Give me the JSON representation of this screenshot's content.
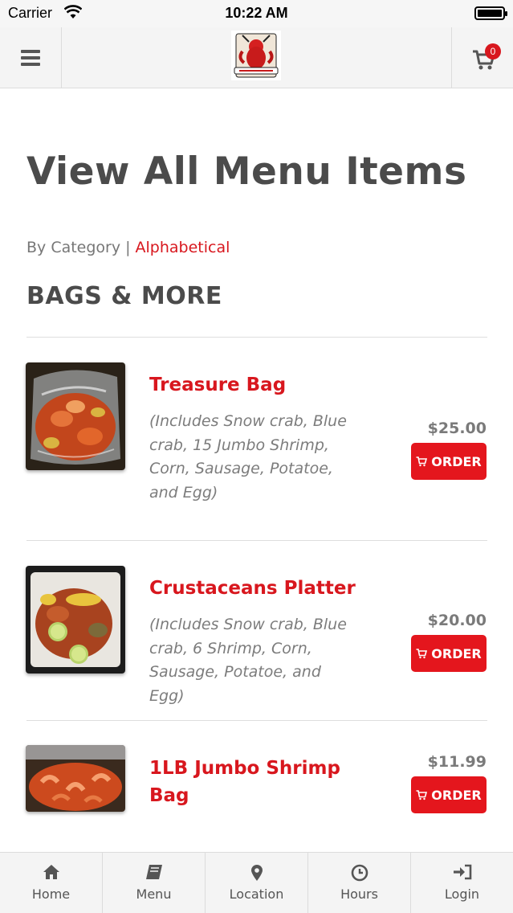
{
  "status_bar": {
    "carrier": "Carrier",
    "time": "10:22 AM"
  },
  "navbar": {
    "cart_count": "0"
  },
  "page": {
    "title": "View All Menu Items",
    "sort": {
      "by_category": "By Category",
      "separator": "|",
      "alphabetical": "Alphabetical"
    },
    "section_title": "BAGS & MORE"
  },
  "items": [
    {
      "name": "Treasure Bag",
      "description": "(Includes Snow crab, Blue crab, 15 Jumbo Shrimp, Corn, Sausage, Potatoe, and Egg)",
      "price": "$25.00",
      "order_label": "ORDER"
    },
    {
      "name": "Crustaceans Platter",
      "description": "(Includes Snow crab, Blue crab, 6 Shrimp, Corn, Sausage, Potatoe, and Egg)",
      "price": "$20.00",
      "order_label": "ORDER"
    },
    {
      "name": "1LB Jumbo Shrimp Bag",
      "description": "",
      "price": "$11.99",
      "order_label": "ORDER"
    }
  ],
  "tabbar": [
    {
      "label": "Home",
      "icon": "home-icon"
    },
    {
      "label": "Menu",
      "icon": "book-icon"
    },
    {
      "label": "Location",
      "icon": "map-pin-icon"
    },
    {
      "label": "Hours",
      "icon": "clock-icon"
    },
    {
      "label": "Login",
      "icon": "sign-in-icon"
    }
  ],
  "colors": {
    "accent": "#e4161d",
    "title_text": "#4b4b4b",
    "muted_text": "#7c7c7c",
    "bar_bg": "#f4f4f4"
  }
}
